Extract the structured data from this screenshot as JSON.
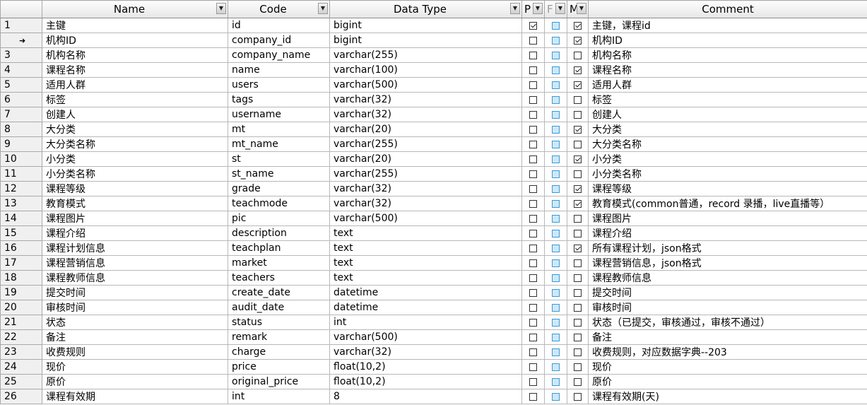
{
  "columns": [
    {
      "label": ""
    },
    {
      "label": "Name"
    },
    {
      "label": "Code"
    },
    {
      "label": "Data Type"
    },
    {
      "label": "P"
    },
    {
      "label": "F"
    },
    {
      "label": "M"
    },
    {
      "label": "Comment"
    }
  ],
  "rows": [
    {
      "num": "1",
      "name": "主键",
      "code": "id",
      "type": "bigint",
      "p": true,
      "f": false,
      "m": true,
      "comment": "主键，课程id"
    },
    {
      "num": "➜",
      "name": "机构ID",
      "code": "company_id",
      "type": "bigint",
      "p": false,
      "f": false,
      "m": true,
      "comment": "机构ID",
      "current": true
    },
    {
      "num": "3",
      "name": "机构名称",
      "code": "company_name",
      "type": "varchar(255)",
      "p": false,
      "f": false,
      "m": false,
      "comment": "机构名称"
    },
    {
      "num": "4",
      "name": "课程名称",
      "code": "name",
      "type": "varchar(100)",
      "p": false,
      "f": false,
      "m": true,
      "comment": "课程名称"
    },
    {
      "num": "5",
      "name": "适用人群",
      "code": "users",
      "type": "varchar(500)",
      "p": false,
      "f": false,
      "m": true,
      "comment": "适用人群"
    },
    {
      "num": "6",
      "name": "标签",
      "code": "tags",
      "type": "varchar(32)",
      "p": false,
      "f": false,
      "m": false,
      "comment": "标签"
    },
    {
      "num": "7",
      "name": "创建人",
      "code": "username",
      "type": "varchar(32)",
      "p": false,
      "f": false,
      "m": false,
      "comment": "创建人"
    },
    {
      "num": "8",
      "name": "大分类",
      "code": "mt",
      "type": "varchar(20)",
      "p": false,
      "f": false,
      "m": true,
      "comment": "大分类"
    },
    {
      "num": "9",
      "name": "大分类名称",
      "code": "mt_name",
      "type": "varchar(255)",
      "p": false,
      "f": false,
      "m": false,
      "comment": "大分类名称"
    },
    {
      "num": "10",
      "name": "小分类",
      "code": "st",
      "type": "varchar(20)",
      "p": false,
      "f": false,
      "m": true,
      "comment": "小分类"
    },
    {
      "num": "11",
      "name": "小分类名称",
      "code": "st_name",
      "type": "varchar(255)",
      "p": false,
      "f": false,
      "m": false,
      "comment": "小分类名称"
    },
    {
      "num": "12",
      "name": "课程等级",
      "code": "grade",
      "type": "varchar(32)",
      "p": false,
      "f": false,
      "m": true,
      "comment": "课程等级"
    },
    {
      "num": "13",
      "name": "教育模式",
      "code": "teachmode",
      "type": "varchar(32)",
      "p": false,
      "f": false,
      "m": true,
      "comment": "教育模式(common普通，record 录播，live直播等）"
    },
    {
      "num": "14",
      "name": "课程图片",
      "code": "pic",
      "type": "varchar(500)",
      "p": false,
      "f": false,
      "m": false,
      "comment": "课程图片"
    },
    {
      "num": "15",
      "name": "课程介绍",
      "code": "description",
      "type": "text",
      "p": false,
      "f": false,
      "m": false,
      "comment": "课程介绍"
    },
    {
      "num": "16",
      "name": "课程计划信息",
      "code": "teachplan",
      "type": "text",
      "p": false,
      "f": false,
      "m": true,
      "comment": "所有课程计划，json格式"
    },
    {
      "num": "17",
      "name": "课程营销信息",
      "code": "market",
      "type": "text",
      "p": false,
      "f": false,
      "m": false,
      "comment": "课程营销信息，json格式"
    },
    {
      "num": "18",
      "name": "课程教师信息",
      "code": "teachers",
      "type": "text",
      "p": false,
      "f": false,
      "m": false,
      "comment": "课程教师信息"
    },
    {
      "num": "19",
      "name": "提交时间",
      "code": "create_date",
      "type": "datetime",
      "p": false,
      "f": false,
      "m": false,
      "comment": "提交时间"
    },
    {
      "num": "20",
      "name": "审核时间",
      "code": "audit_date",
      "type": "datetime",
      "p": false,
      "f": false,
      "m": false,
      "comment": "审核时间"
    },
    {
      "num": "21",
      "name": "状态",
      "code": "status",
      "type": "int",
      "p": false,
      "f": false,
      "m": false,
      "comment": "状态（已提交，审核通过，审核不通过）"
    },
    {
      "num": "22",
      "name": "备注",
      "code": "remark",
      "type": "varchar(500)",
      "p": false,
      "f": false,
      "m": false,
      "comment": "备注"
    },
    {
      "num": "23",
      "name": "收费规则",
      "code": "charge",
      "type": "varchar(32)",
      "p": false,
      "f": false,
      "m": false,
      "comment": "收费规则，对应数据字典--203"
    },
    {
      "num": "24",
      "name": "现价",
      "code": "price",
      "type": "float(10,2)",
      "p": false,
      "f": false,
      "m": false,
      "comment": "现价"
    },
    {
      "num": "25",
      "name": "原价",
      "code": "original_price",
      "type": "float(10,2)",
      "p": false,
      "f": false,
      "m": false,
      "comment": "原价"
    },
    {
      "num": "26",
      "name": "课程有效期",
      "code": "int",
      "type": "8",
      "p": false,
      "f": false,
      "m": false,
      "comment": "课程有效期(天)"
    }
  ]
}
